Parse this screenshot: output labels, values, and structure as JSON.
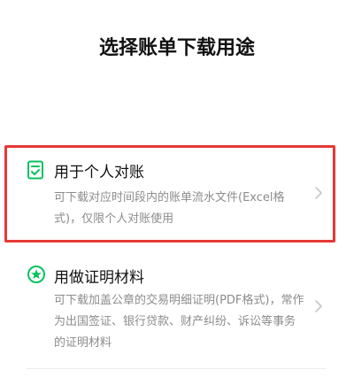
{
  "page": {
    "title": "选择账单下载用途"
  },
  "options": [
    {
      "icon": "document-check-icon",
      "title": "用于个人对账",
      "description": "可下载对应时间段内的账单流水文件(Excel格式)，仅限个人对账使用",
      "selected": true
    },
    {
      "icon": "star-badge-icon",
      "title": "用做证明材料",
      "description": "可下载加盖公章的交易明细证明(PDF格式)，常作为出国签证、银行贷款、财产纠纷、诉讼等事务的证明材料",
      "selected": false
    }
  ],
  "colors": {
    "accent": "#07c160",
    "highlight_border": "#e53935",
    "title_text": "#111111",
    "secondary_text": "#8c8c8c",
    "chevron": "#c7c7c7"
  }
}
